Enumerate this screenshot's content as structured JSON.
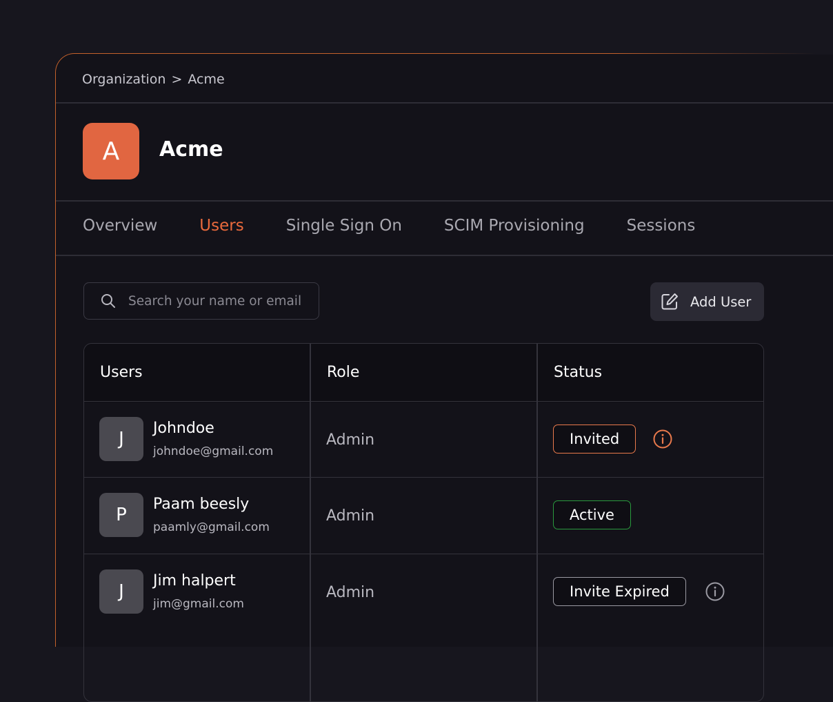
{
  "breadcrumb": {
    "root": "Organization",
    "separator": ">",
    "current": "Acme"
  },
  "org": {
    "initial": "A",
    "name": "Acme",
    "avatar_color": "#e16641"
  },
  "tabs": [
    {
      "label": "Overview",
      "active": false
    },
    {
      "label": "Users",
      "active": true
    },
    {
      "label": "Single Sign On",
      "active": false
    },
    {
      "label": "SCIM Provisioning",
      "active": false
    },
    {
      "label": "Sessions",
      "active": false
    }
  ],
  "search": {
    "placeholder": "Search your name or email",
    "value": ""
  },
  "toolbar": {
    "add_user_label": "Add User"
  },
  "table": {
    "headers": [
      "Users",
      "Role",
      "Status"
    ],
    "rows": [
      {
        "initial": "J",
        "name": "Johndoe",
        "email": "johndoe@gmail.com",
        "role": "Admin",
        "status": "Invited",
        "status_color": "#ea7a4c",
        "info_icon": "info-icon-orange"
      },
      {
        "initial": "P",
        "name": "Paam beesly",
        "email": "paamly@gmail.com",
        "role": "Admin",
        "status": "Active",
        "status_color": "#2a9a3e"
      },
      {
        "initial": "J",
        "name": "Jim halpert",
        "email": "jim@gmail.com",
        "role": "Admin",
        "status": "Invite Expired",
        "status_color": "#9b9aa3",
        "info_icon": "info-icon-gray"
      }
    ]
  },
  "colors": {
    "accent": "#ea6a3c",
    "background": "#17161e",
    "panel": "#131219"
  }
}
